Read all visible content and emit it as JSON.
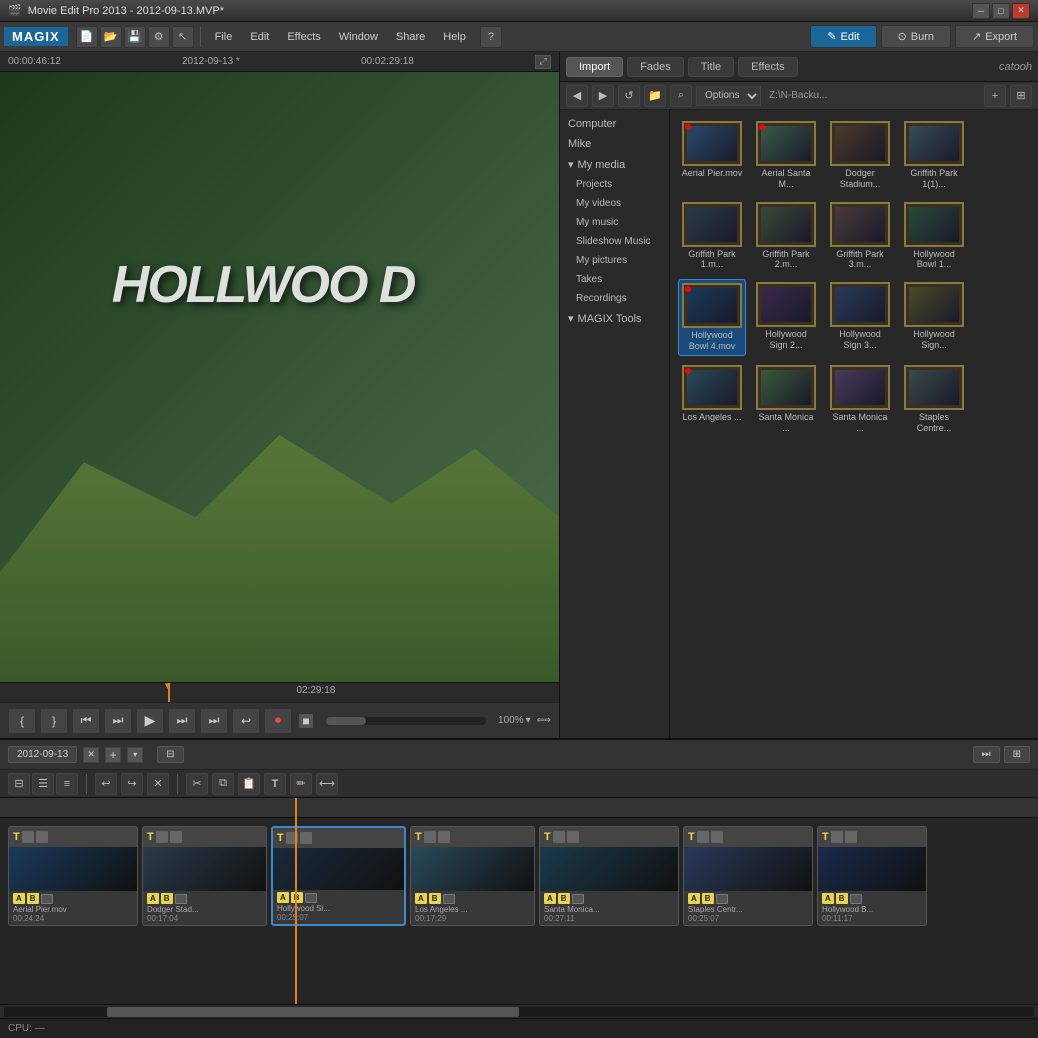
{
  "titlebar": {
    "title": "Movie Edit Pro 2013 - 2012-09-13.MVP*",
    "icon": "film-icon",
    "controls": [
      "minimize",
      "maximize",
      "close"
    ]
  },
  "menubar": {
    "logo": "MAGIX",
    "menus": [
      "File",
      "Edit",
      "Effects",
      "Window",
      "Share",
      "Help"
    ],
    "toolbar_icons": [
      "new",
      "open",
      "save",
      "settings",
      "cursor"
    ],
    "tabs": [
      {
        "label": "Edit",
        "active": true
      },
      {
        "label": "Burn",
        "active": false
      },
      {
        "label": "Export",
        "active": false
      }
    ]
  },
  "preview": {
    "time_left": "00:00:46:12",
    "date": "2012-09-13 *",
    "time_right": "00:02:29:18",
    "timeline_time": "02:29:18",
    "content": "Hollywood Sign footage",
    "controls": [
      "mark-in",
      "mark-out",
      "prev-frame",
      "start",
      "play",
      "end",
      "next-frame",
      "loop",
      "record",
      "stop"
    ],
    "zoom": "100%"
  },
  "panel": {
    "tabs": [
      "Import",
      "Fades",
      "Title",
      "Effects"
    ],
    "active_tab": "Import",
    "brand": "catooh",
    "options_label": "Options",
    "path_label": "Z:\\N-Backu...",
    "nav_items": [
      {
        "label": "Computer",
        "indent": false
      },
      {
        "label": "Mike",
        "indent": false
      },
      {
        "label": "My media",
        "indent": false,
        "expandable": true
      },
      {
        "label": "Projects",
        "indent": true
      },
      {
        "label": "My videos",
        "indent": true
      },
      {
        "label": "My music",
        "indent": true
      },
      {
        "label": "Slideshow Music",
        "indent": true
      },
      {
        "label": "My pictures",
        "indent": true
      },
      {
        "label": "Takes",
        "indent": true
      },
      {
        "label": "Recordings",
        "indent": true
      },
      {
        "label": "MAGIX Tools",
        "indent": false,
        "expandable": true
      }
    ],
    "files": [
      {
        "name": "Aerial Pier.mov",
        "has_dot": true,
        "thumb_color": "#2a4a6a"
      },
      {
        "name": "Aerial Santa M...",
        "has_dot": true,
        "thumb_color": "#3a5a4a"
      },
      {
        "name": "Dodger Stadium...",
        "has_dot": false,
        "thumb_color": "#4a3a2a"
      },
      {
        "name": "Griffith Park 1(1)...",
        "has_dot": false,
        "thumb_color": "#3a4a5a",
        "label_short": "Griffith Park"
      },
      {
        "name": "Griffith Park 1.m...",
        "has_dot": false,
        "thumb_color": "#2a3a4a"
      },
      {
        "name": "Griffith Park 2.m...",
        "has_dot": false,
        "thumb_color": "#3a4a3a"
      },
      {
        "name": "Griffith Park 3.m...",
        "has_dot": false,
        "thumb_color": "#4a3a3a"
      },
      {
        "name": "Hollywood Bowl 1...",
        "has_dot": false,
        "thumb_color": "#2a4a3a"
      },
      {
        "name": "Hollywood Bowl 4.mov",
        "has_dot": true,
        "thumb_color": "#1a3a5a",
        "selected": true
      },
      {
        "name": "Hollywood Sign 2...",
        "has_dot": false,
        "thumb_color": "#3a2a4a"
      },
      {
        "name": "Hollywood Sign 3...",
        "has_dot": false,
        "thumb_color": "#2a3a5a"
      },
      {
        "name": "Hollywood Sign...",
        "has_dot": false,
        "thumb_color": "#4a4a2a"
      },
      {
        "name": "Los Angeles ...",
        "has_dot": true,
        "thumb_color": "#2a4a5a"
      },
      {
        "name": "Santa Monica ...",
        "has_dot": false,
        "thumb_color": "#3a5a3a"
      },
      {
        "name": "Santa Monica ...",
        "has_dot": false,
        "thumb_color": "#4a3a5a"
      },
      {
        "name": "Staples Centre...",
        "has_dot": false,
        "thumb_color": "#3a4a4a"
      }
    ]
  },
  "timeline": {
    "tab_label": "2012-09-13",
    "view_icons": [
      "storyboard",
      "timeline",
      "list"
    ],
    "tools": [
      "undo",
      "redo",
      "delete",
      "cut",
      "copy",
      "paste",
      "text",
      "effects",
      "transitions"
    ],
    "clips": [
      {
        "name": "Aerial Pier.mov",
        "duration": "00:24:24",
        "width": 130,
        "thumb_color": "#1a3a5a",
        "selected": false
      },
      {
        "name": "Dodger Stad...",
        "duration": "00:17:04",
        "width": 125,
        "thumb_color": "#2a3a4a",
        "selected": false
      },
      {
        "name": "Hollywood Si...",
        "duration": "00:25:07",
        "width": 135,
        "thumb_color": "#1a2a3a",
        "selected": true
      },
      {
        "name": "Los Angeles ...",
        "duration": "00:17:29",
        "width": 125,
        "thumb_color": "#2a4a5a",
        "selected": false
      },
      {
        "name": "Santa Monica...",
        "duration": "00:27:11",
        "width": 140,
        "thumb_color": "#1a3a4a",
        "selected": false
      },
      {
        "name": "Staples Centr...",
        "duration": "00:25:07",
        "width": 130,
        "thumb_color": "#2a3a5a",
        "selected": false
      },
      {
        "name": "Hollywood B...",
        "duration": "00:11:17",
        "width": 110,
        "thumb_color": "#1a2a4a",
        "selected": false
      }
    ]
  },
  "statusbar": {
    "label": "CPU: —"
  }
}
